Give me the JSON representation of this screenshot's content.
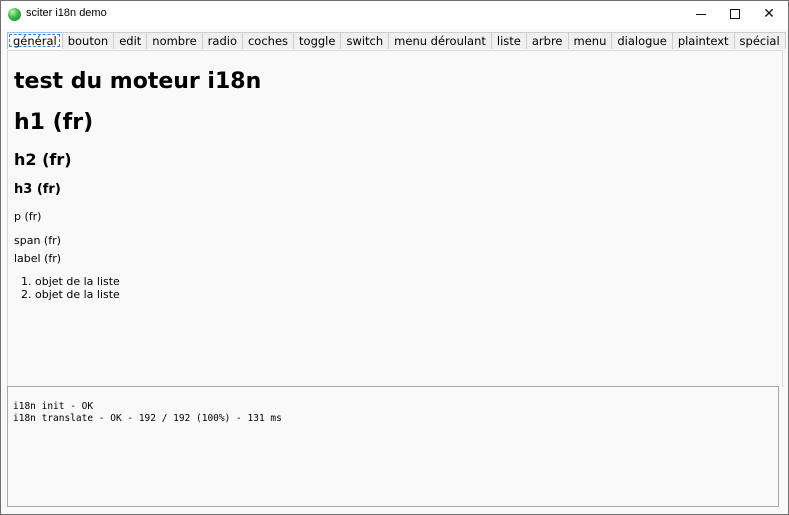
{
  "window": {
    "title": "sciter i18n demo",
    "app_icon": "sciter-logo-icon",
    "controls": {
      "minimize": "minimize-icon",
      "maximize": "maximize-icon",
      "close": "close-icon"
    }
  },
  "tabs": [
    {
      "label": "général",
      "active": true
    },
    {
      "label": "bouton"
    },
    {
      "label": "edit"
    },
    {
      "label": "nombre"
    },
    {
      "label": "radio"
    },
    {
      "label": "coches"
    },
    {
      "label": "toggle"
    },
    {
      "label": "switch"
    },
    {
      "label": "menu déroulant"
    },
    {
      "label": "liste"
    },
    {
      "label": "arbre"
    },
    {
      "label": "menu"
    },
    {
      "label": "dialogue"
    },
    {
      "label": "plaintext"
    },
    {
      "label": "spécial"
    }
  ],
  "content": {
    "title": "test du moteur i18n",
    "h1": "h1 (fr)",
    "h2": "h2 (fr)",
    "h3": "h3 (fr)",
    "p": "p (fr)",
    "span": "span (fr)",
    "label": "label (fr)",
    "list_items": [
      "objet de la liste",
      "objet de la liste"
    ]
  },
  "log": {
    "lines": [
      "i18n init - OK",
      "i18n translate - OK - 192 / 192 (100%) - 131 ms"
    ]
  }
}
